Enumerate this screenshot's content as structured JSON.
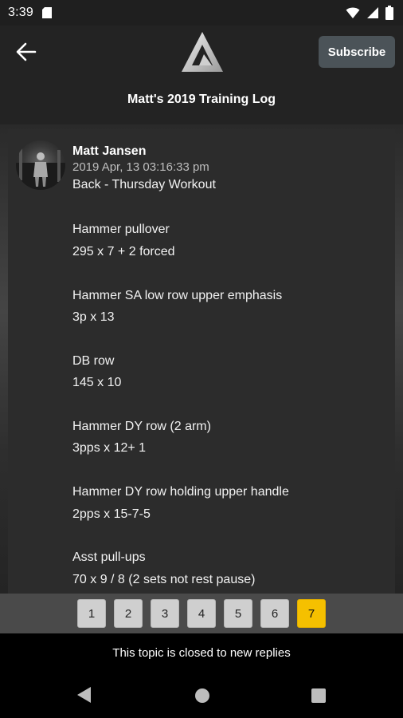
{
  "status_bar": {
    "time": "3:39"
  },
  "header": {
    "title": "Matt's 2019 Training Log",
    "subscribe_label": "Subscribe"
  },
  "post": {
    "author": "Matt Jansen",
    "date": "2019 Apr, 13 03:16:33 pm",
    "subject": "Back - Thursday Workout",
    "lines": [
      "",
      "Hammer pullover",
      "295 x 7 + 2 forced",
      "",
      "Hammer SA low row upper emphasis",
      "3p x 13",
      "",
      "DB row",
      "145 x 10",
      "",
      "Hammer DY row (2 arm)",
      "3pps x 12+ 1",
      "",
      "Hammer DY row holding upper handle",
      "2pps x 15-7-5",
      "",
      "Asst pull-ups",
      "70 x 9 / 8 (2 sets not rest pause)"
    ]
  },
  "pagination": {
    "pages": [
      "1",
      "2",
      "3",
      "4",
      "5",
      "6",
      "7"
    ],
    "current": "7"
  },
  "footer": {
    "closed_message": "This topic is closed to new replies"
  },
  "colors": {
    "accent": "#f5c000",
    "subscribe_bg": "#4b5358",
    "background": "#1e1e1e"
  }
}
